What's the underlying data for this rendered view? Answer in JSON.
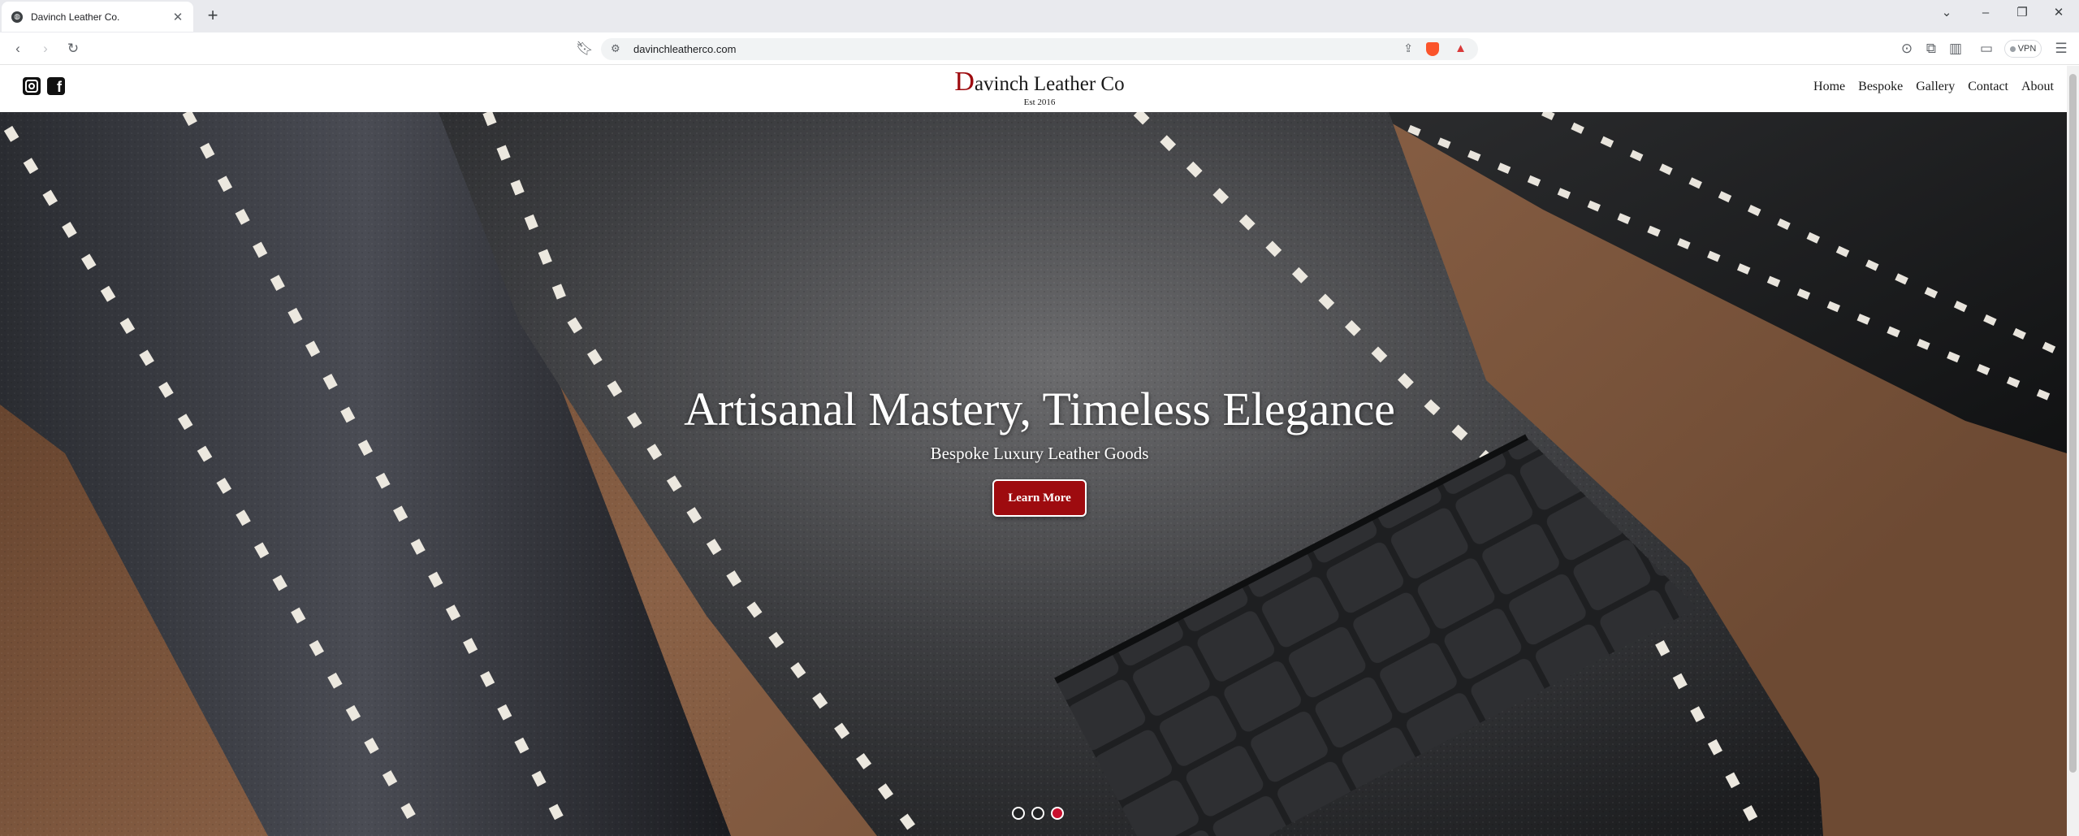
{
  "browser": {
    "tab_title": "Davinch Leather Co.",
    "url": "davinchleatherco.com",
    "vpn_label": "VPN"
  },
  "site": {
    "brand_initial": "D",
    "brand_rest": "avinch Leather Co",
    "established": "Est 2016",
    "nav": [
      "Home",
      "Bespoke",
      "Gallery",
      "Contact",
      "About"
    ],
    "social": [
      "instagram-icon",
      "facebook-icon"
    ]
  },
  "hero": {
    "title": "Artisanal Mastery, Timeless Elegance",
    "subtitle": "Bespoke Luxury Leather Goods",
    "cta_label": "Learn More",
    "slides_total": 3,
    "active_slide": 3
  },
  "colors": {
    "accent": "#9e0b0f",
    "active_dot": "#c8102e"
  }
}
